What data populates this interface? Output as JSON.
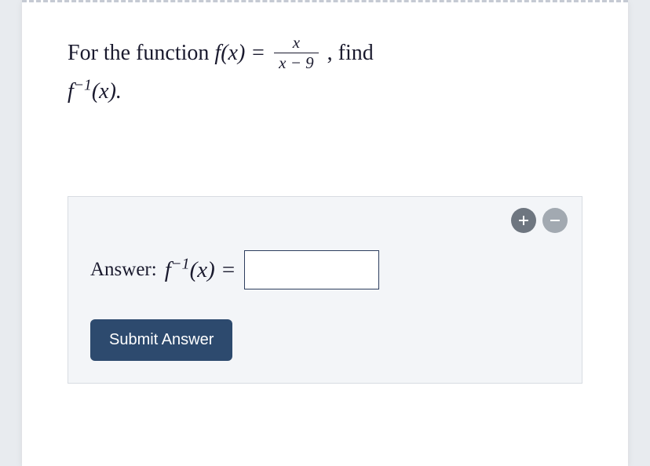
{
  "question": {
    "prefix": "For the function ",
    "fn_left": "f(x) = ",
    "fraction": {
      "numerator": "x",
      "denominator": "x − 9"
    },
    "suffix": ", find",
    "line2_fn": "f",
    "line2_exp": "−1",
    "line2_arg": "(x)."
  },
  "answer": {
    "label": "Answer:",
    "fn": "f",
    "exp": "−1",
    "arg": "(x) =",
    "input_value": ""
  },
  "buttons": {
    "submit": "Submit Answer"
  }
}
